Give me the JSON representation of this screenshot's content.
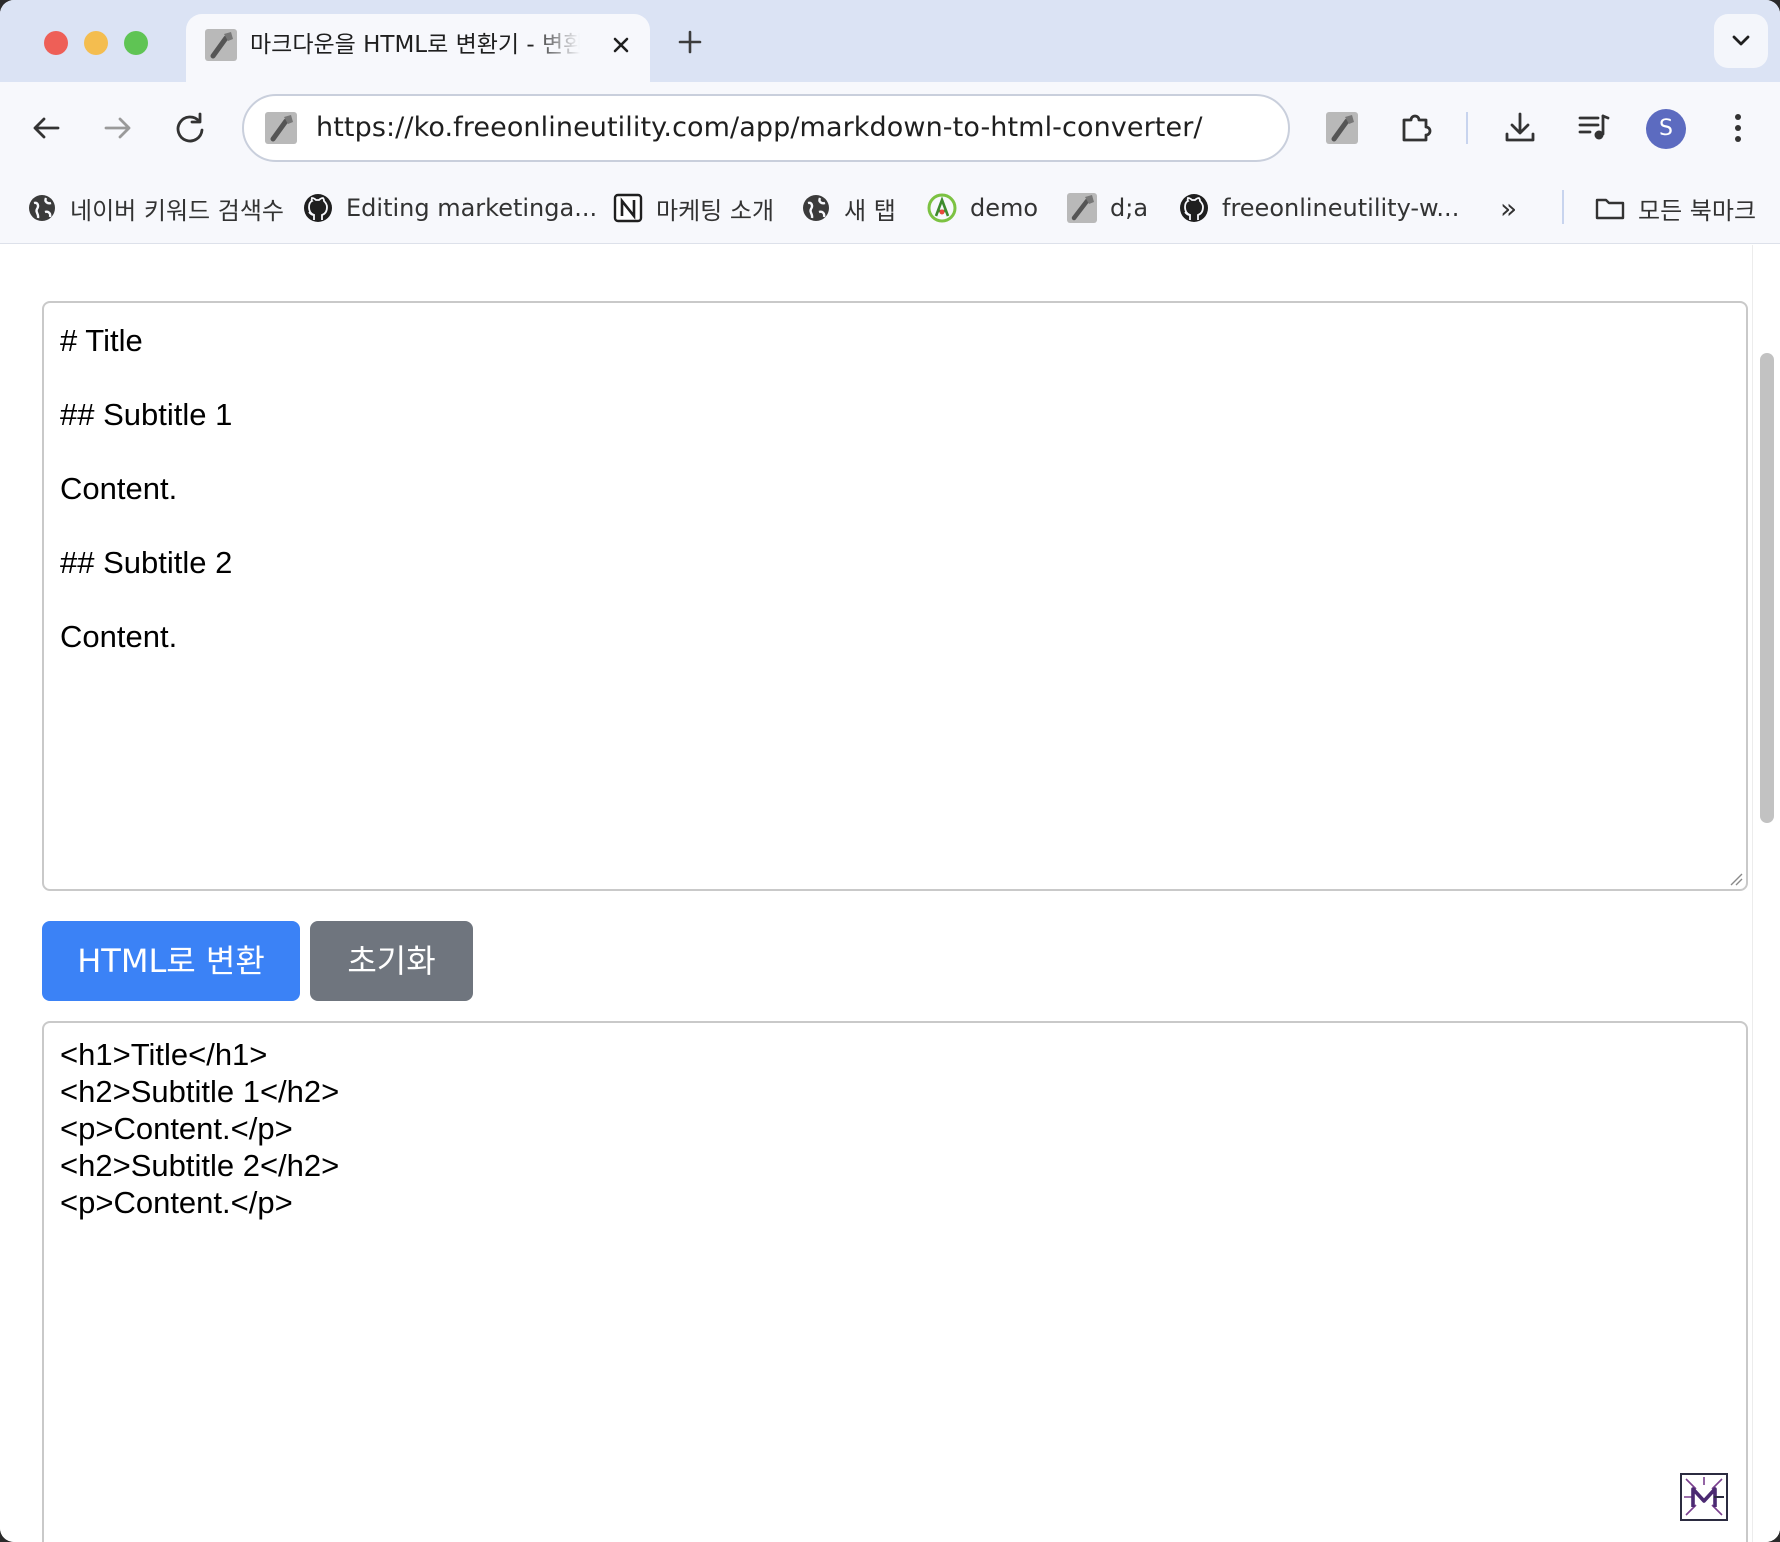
{
  "window": {
    "tab": {
      "title": "마크다운을 HTML로 변환기 - 변환기"
    },
    "address_bar": {
      "url": "https://ko.freeonlineutility.com/app/markdown-to-html-converter/"
    },
    "profile": {
      "initial": "S"
    }
  },
  "bookmarks": [
    {
      "label": "네이버 키워드 검색수",
      "icon": "globe-icon"
    },
    {
      "label": "Editing marketinga...",
      "icon": "github-icon"
    },
    {
      "label": "마케팅 소개",
      "icon": "notion-icon"
    },
    {
      "label": "새 탭",
      "icon": "globe-icon"
    },
    {
      "label": "demo",
      "icon": "app-icon"
    },
    {
      "label": "d;a",
      "icon": "wrench-icon"
    },
    {
      "label": "freeonlineutility-w...",
      "icon": "github-icon"
    }
  ],
  "bookmarks_overflow": "»",
  "all_bookmarks": {
    "label": "모든 북마크",
    "icon": "folder-icon"
  },
  "editor": {
    "markdown_lines": [
      "# Title",
      "## Subtitle 1",
      "Content.",
      "## Subtitle 2",
      "Content."
    ],
    "convert_button": "HTML로 변환",
    "reset_button": "초기화",
    "html_lines": [
      "<h1>Title</h1>",
      "<h2>Subtitle 1</h2>",
      "<p>Content.</p>",
      "<h2>Subtitle 2</h2>",
      "<p>Content.</p>"
    ]
  },
  "colors": {
    "convert_button": "#3b82f6",
    "reset_button": "#6f757e",
    "tab_strip": "#dbe3f4"
  }
}
